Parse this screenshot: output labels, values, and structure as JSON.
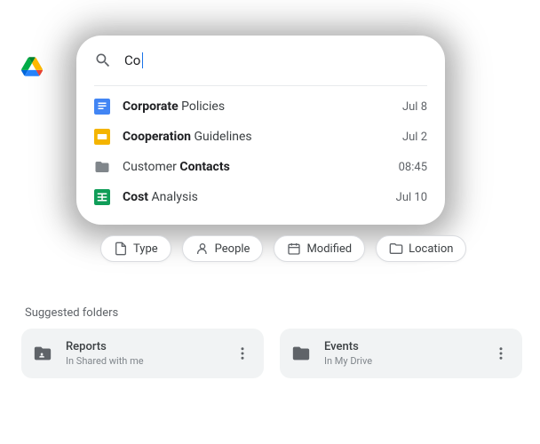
{
  "search": {
    "query": "Co"
  },
  "results": [
    {
      "type": "docs",
      "pre": "Co",
      "bold": "rporate",
      "post": " Policies",
      "date": "Jul 8"
    },
    {
      "type": "slides",
      "pre": "Co",
      "bold": "operation",
      "post": " Guidelines",
      "date": "Jul 2"
    },
    {
      "type": "folder",
      "pre": "Customer ",
      "bold": "Contacts",
      "post": "",
      "date": "08:45"
    },
    {
      "type": "sheets",
      "pre": "Co",
      "bold": "st",
      "post": " Analysis",
      "date": "Jul 10"
    }
  ],
  "chips": {
    "type": "Type",
    "people": "People",
    "modified": "Modified",
    "location": "Location"
  },
  "suggested": {
    "label": "Suggested folders",
    "folders": [
      {
        "title": "Reports",
        "sub": "In Shared with me",
        "icon": "shared"
      },
      {
        "title": "Events",
        "sub": "In My Drive",
        "icon": "folder"
      }
    ]
  }
}
